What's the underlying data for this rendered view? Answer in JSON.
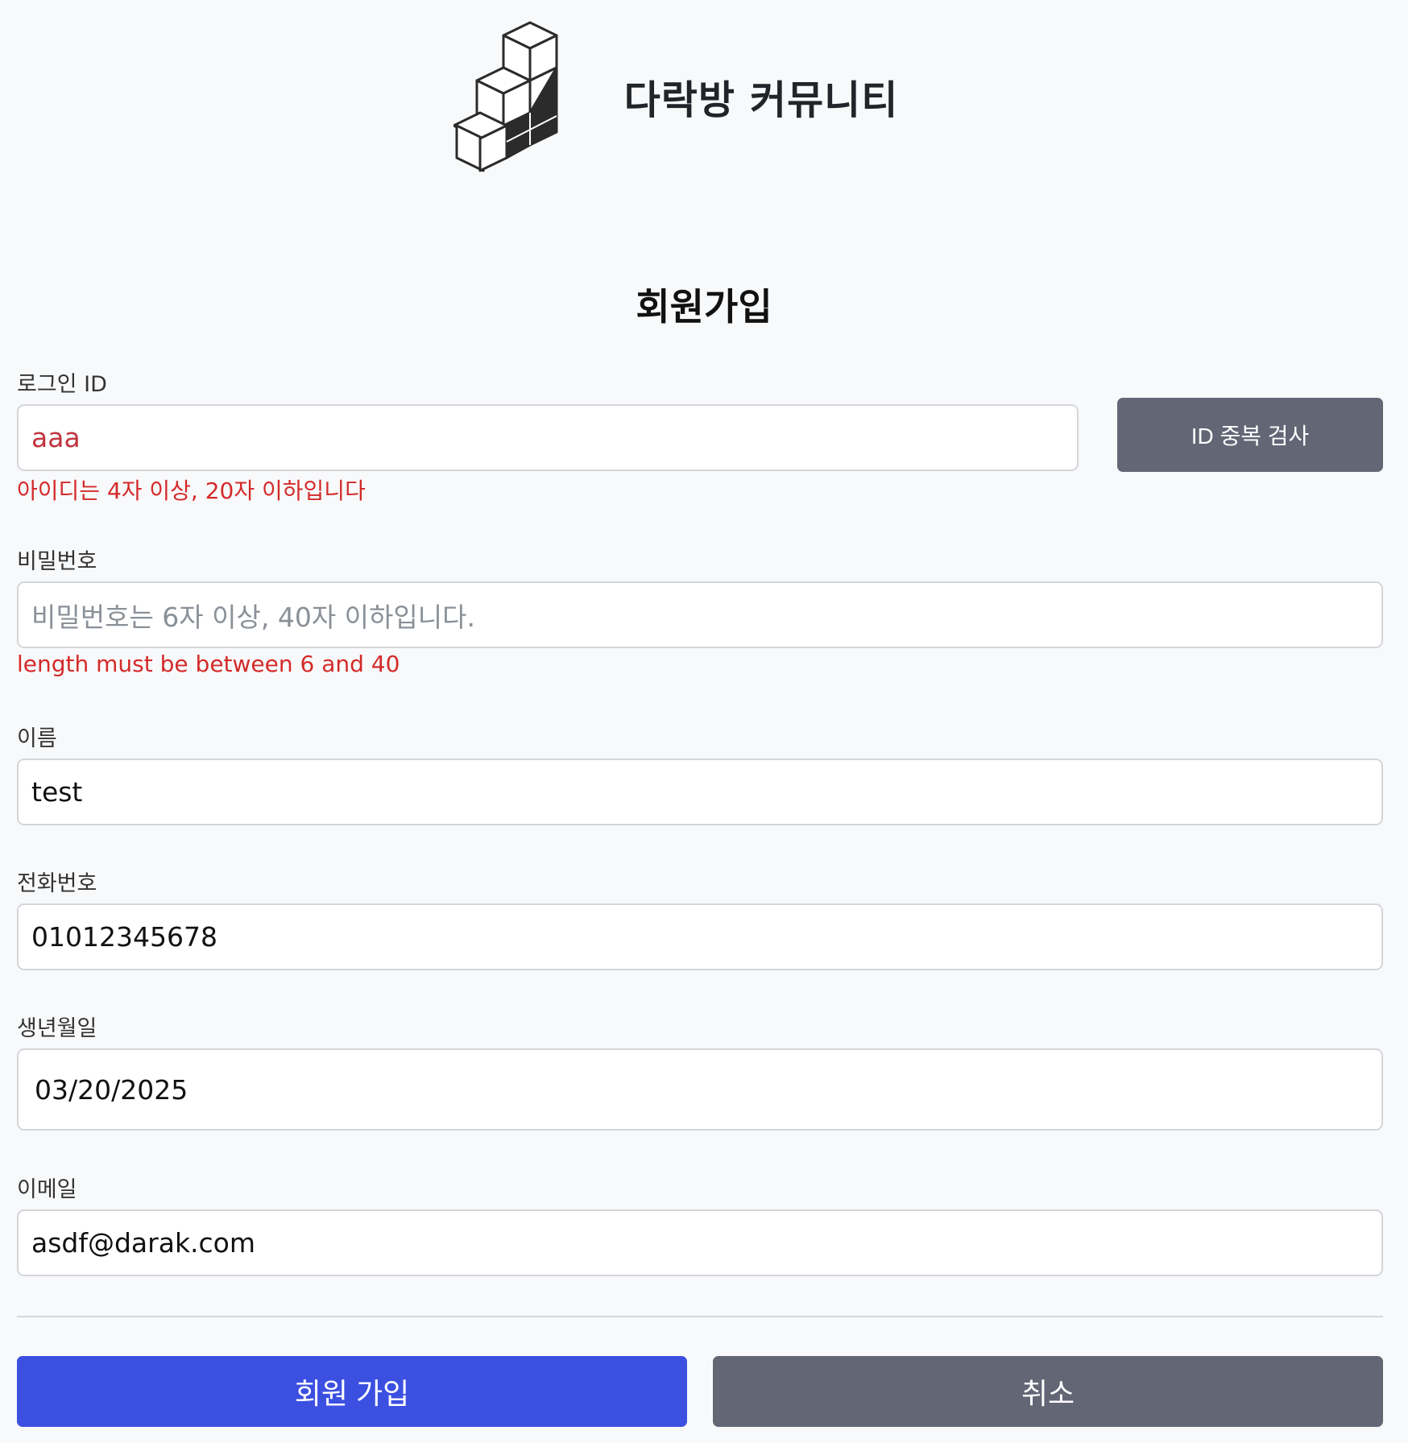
{
  "brand": {
    "name": "다락방 커뮤니티",
    "logo_icon": "stacked-cubes-logo-icon"
  },
  "form": {
    "title": "회원가입",
    "login_id": {
      "label": "로그인 ID",
      "value": "aaa",
      "error": "아이디는 4자 이상, 20자 이하입니다",
      "check_button": "ID 중복 검사"
    },
    "password": {
      "label": "비밀번호",
      "value": "",
      "placeholder": "비밀번호는 6자 이상, 40자 이하입니다.",
      "error": "length must be between 6 and 40"
    },
    "name": {
      "label": "이름",
      "value": "test"
    },
    "phone": {
      "label": "전화번호",
      "value": "01012345678"
    },
    "birthdate": {
      "label": "생년월일",
      "value": "03/20/2025"
    },
    "email": {
      "label": "이메일",
      "value": "asdf@darak.com"
    },
    "submit_label": "회원 가입",
    "cancel_label": "취소"
  },
  "colors": {
    "primary": "#3b50e0",
    "secondary": "#626675",
    "error": "#d42a2a",
    "background": "#f8f9fa"
  }
}
